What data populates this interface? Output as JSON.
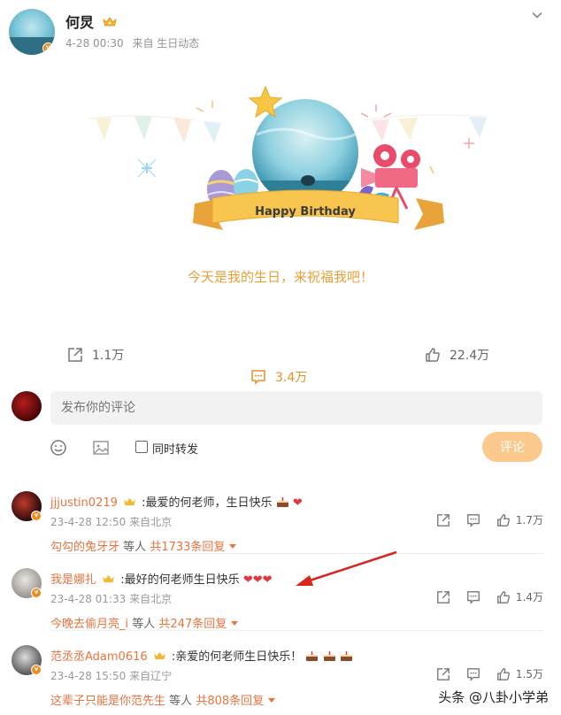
{
  "post": {
    "username": "何炅",
    "time": "4-28 00:30",
    "source": "来自 生日动态",
    "banner_text": "Happy Birthday",
    "caption": "今天是我的生日，来祝福我吧！",
    "shares": "1.1万",
    "comments": "3.4万",
    "likes": "22.4万"
  },
  "composer": {
    "placeholder": "发布你的评论",
    "repost_label": "同时转发",
    "submit_label": "评论"
  },
  "comments": [
    {
      "user": "jjjustin0219",
      "text": ":最爱的何老师，生日快乐",
      "emoji": "cake-heart",
      "time": "23-4-28 12:50",
      "location": "来自北京",
      "likes": "1.7万",
      "reply_user": "勾勾的兔牙牙",
      "reply_mid": "等人",
      "reply_count": "共1733条回复"
    },
    {
      "user": "我是娜扎",
      "text": ":最好的何老师生日快乐",
      "emoji": "hearts",
      "time": "23-4-28 01:33",
      "location": "来自北京",
      "likes": "1.4万",
      "reply_user": "今晚去偷月亮_i",
      "reply_mid": "等人",
      "reply_count": "共247条回复"
    },
    {
      "user": "范丞丞Adam0616",
      "text": ":亲爱的何老师生日快乐！",
      "emoji": "cakes",
      "time": "23-4-28 15:50",
      "location": "来自辽宁",
      "likes": "1.5万",
      "reply_user": "这辈子只能是你范先生",
      "reply_mid": "等人",
      "reply_count": "共808条回复"
    }
  ],
  "watermark": "头条 @八卦小学弟",
  "colors": {
    "accent": "#e6921e",
    "username_link": "#eb7340",
    "caption": "#e8a03a",
    "submit_bg": "#fbc98c",
    "annotation_arrow": "#d9261c"
  }
}
